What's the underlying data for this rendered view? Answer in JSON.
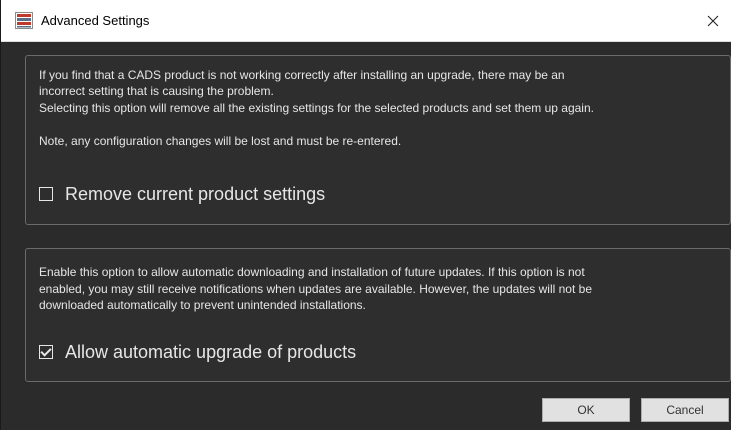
{
  "window": {
    "title": "Advanced Settings",
    "close_glyph": "✕",
    "app_icon": "cads-app-icon",
    "close_icon": "close-icon"
  },
  "reset_section": {
    "line1": "If you find that a CADS product is not working correctly after installing an upgrade, there may be an",
    "line2": "incorrect setting that is causing the problem.",
    "line3": "Selecting this option will remove all the existing settings for the selected products and set them up again.",
    "line4": "Note, any configuration changes will be lost and must be re-entered.",
    "checkbox_label": "Remove current product settings",
    "checked": false
  },
  "upgrade_section": {
    "line1": "Enable this option to allow automatic downloading and installation of future updates. If this option is not",
    "line2": "enabled, you may still receive notifications when updates are available. However, the updates will not be",
    "line3": "downloaded automatically to prevent unintended installations.",
    "checkbox_label": "Allow automatic upgrade of products",
    "checked": true
  },
  "buttons": {
    "ok_label": "OK",
    "cancel_label": "Cancel"
  },
  "colors": {
    "background": "#2b2b2b",
    "text": "#e6e6e6",
    "panel_border": "#6b6b6b",
    "titlebar": "#ffffff",
    "button_face": "#e1e1e1"
  }
}
